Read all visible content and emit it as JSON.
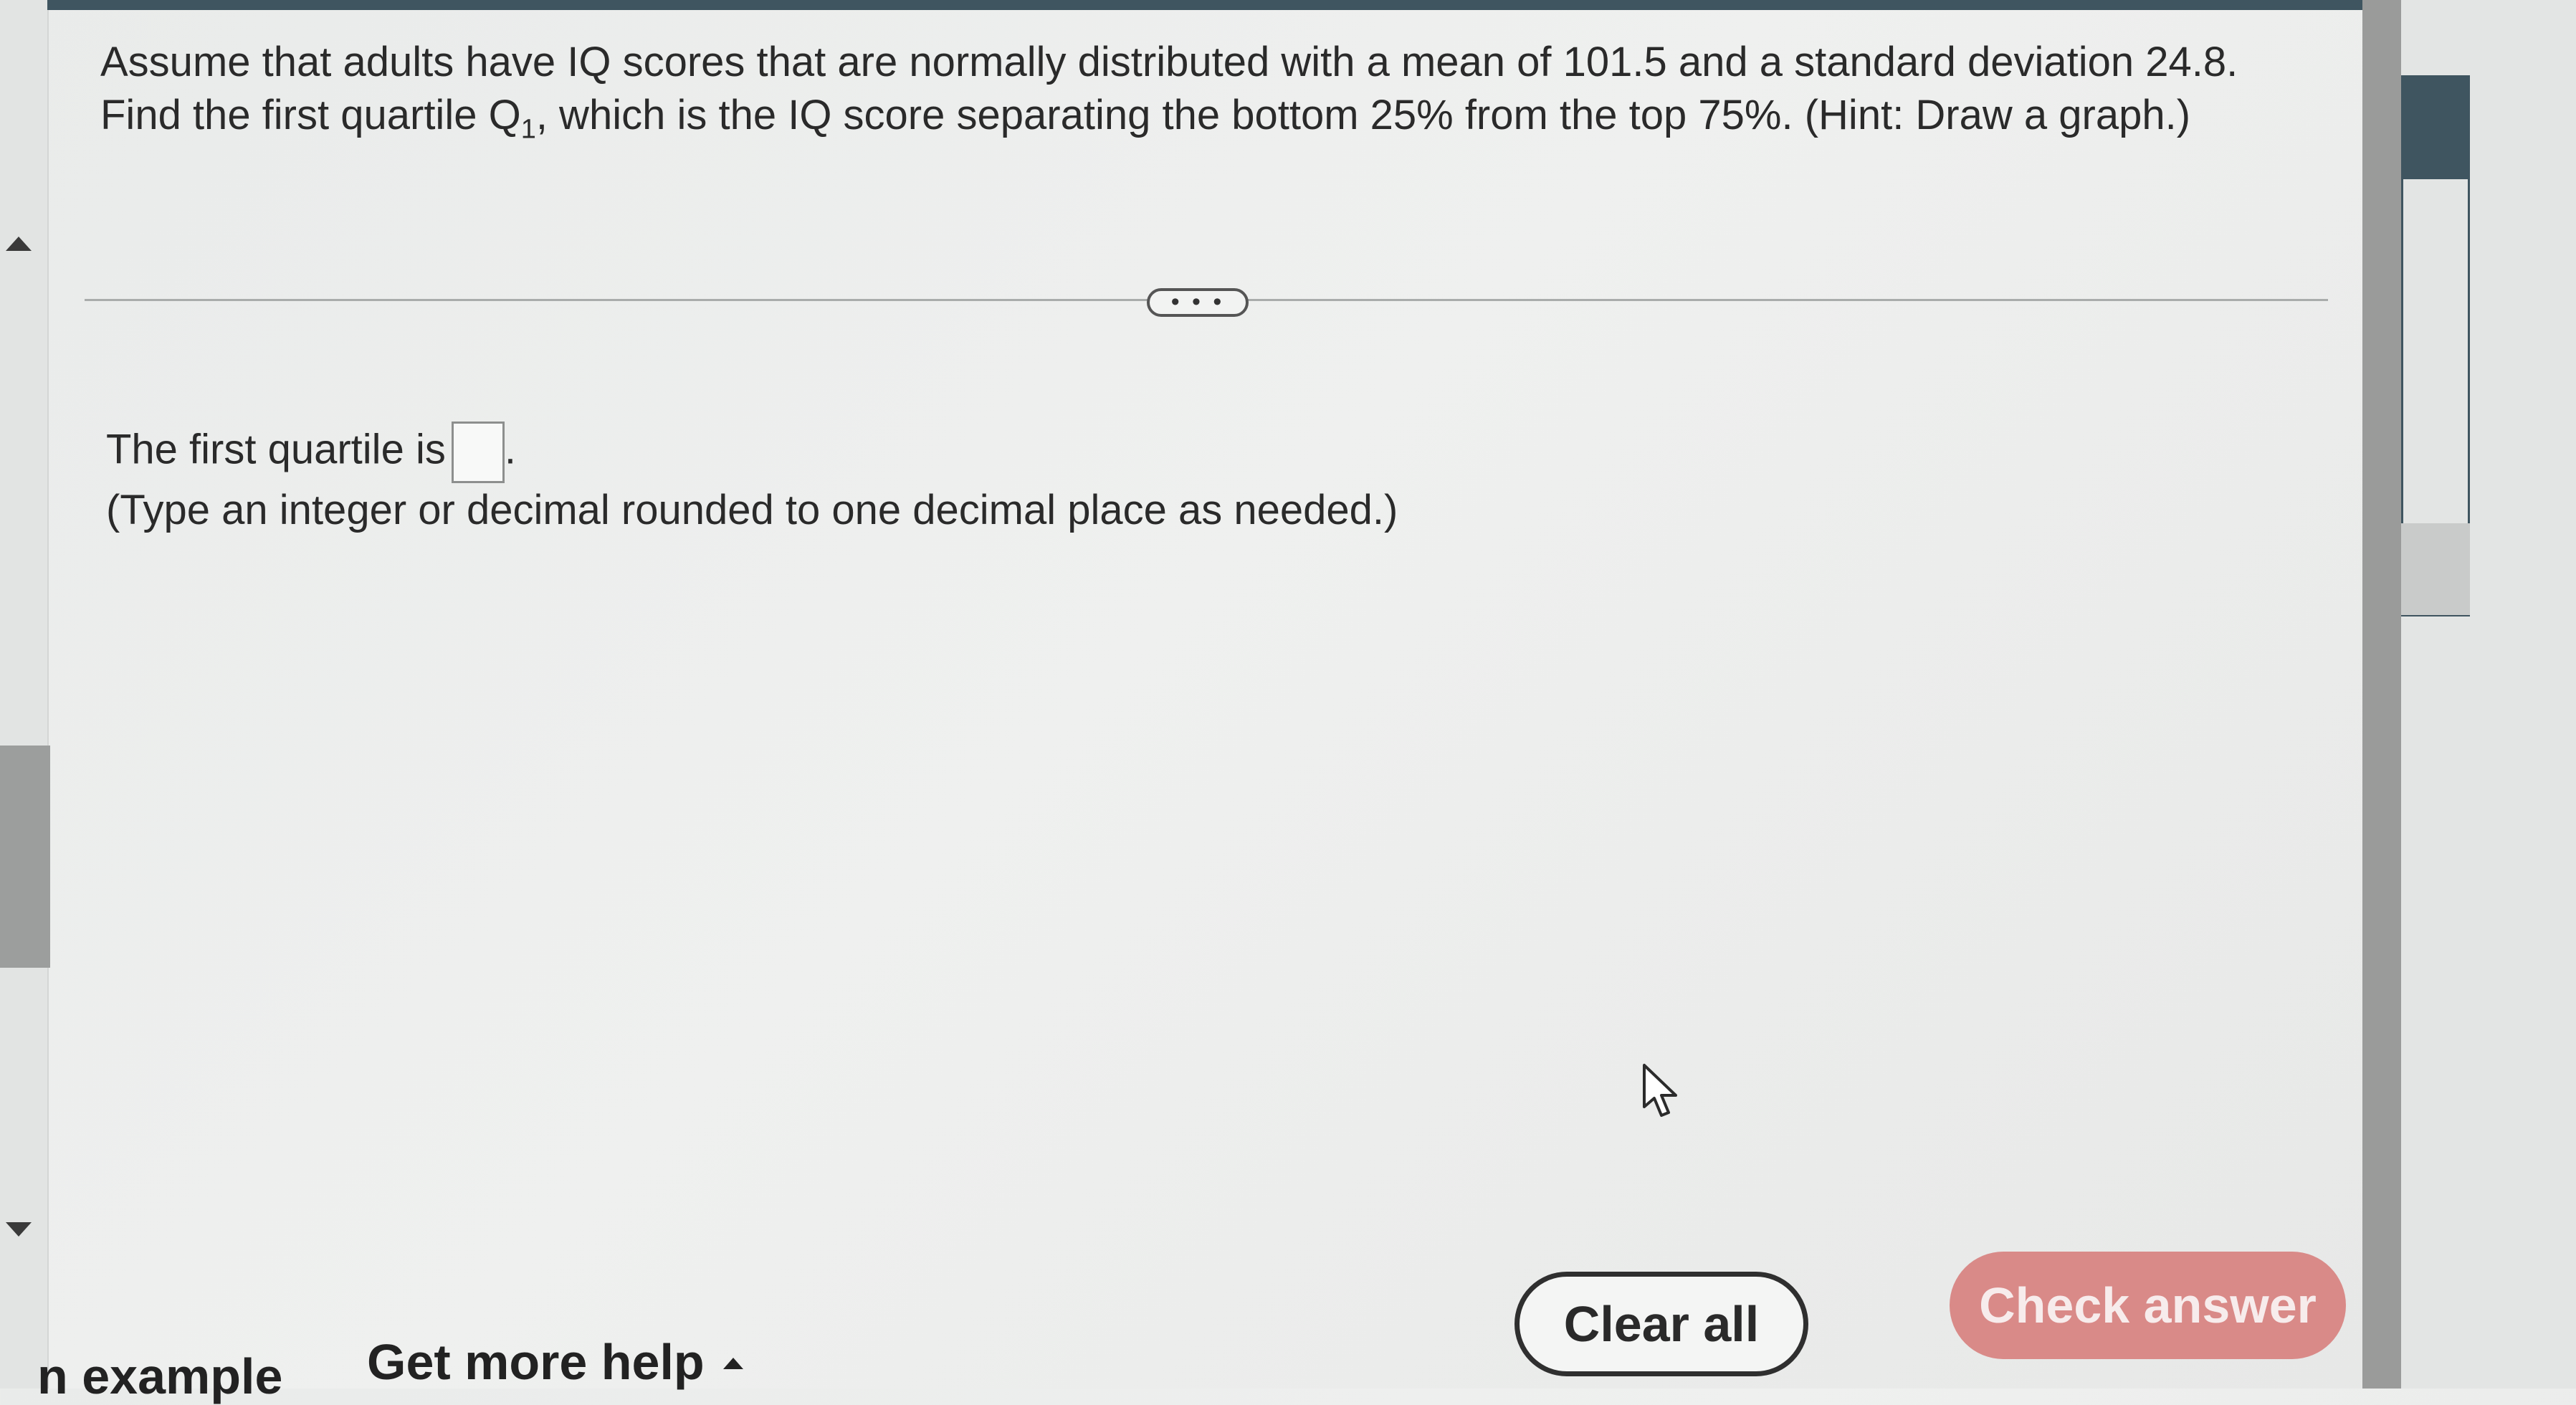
{
  "question": {
    "line1": "Assume that adults have IQ scores that are normally distributed with a mean of 101.5 and a standard deviation 24.8.",
    "line2_prefix": "Find the first quartile Q",
    "line2_subscript": "1",
    "line2_suffix": ", which is the IQ score separating the bottom 25% from the top 75%. (Hint: Draw a graph.)"
  },
  "divider": {
    "more_label": "• • •"
  },
  "answer": {
    "prefix": "The first quartile is",
    "input_value": "",
    "suffix": ".",
    "hint": "(Type an integer or decimal rounded to one decimal place as needed.)"
  },
  "footer": {
    "example_label": "n example",
    "help_label": "Get more help",
    "clear_label": "Clear all",
    "check_label": "Check answer"
  },
  "icons": {
    "left_scroll_up": "triangle-up",
    "left_scroll_down": "triangle-down",
    "help_caret": "caret-up",
    "cursor": "mouse-pointer"
  },
  "colors": {
    "header_bar": "#3f5560",
    "check_button": "#d98a88",
    "text": "#2a2a2a"
  }
}
